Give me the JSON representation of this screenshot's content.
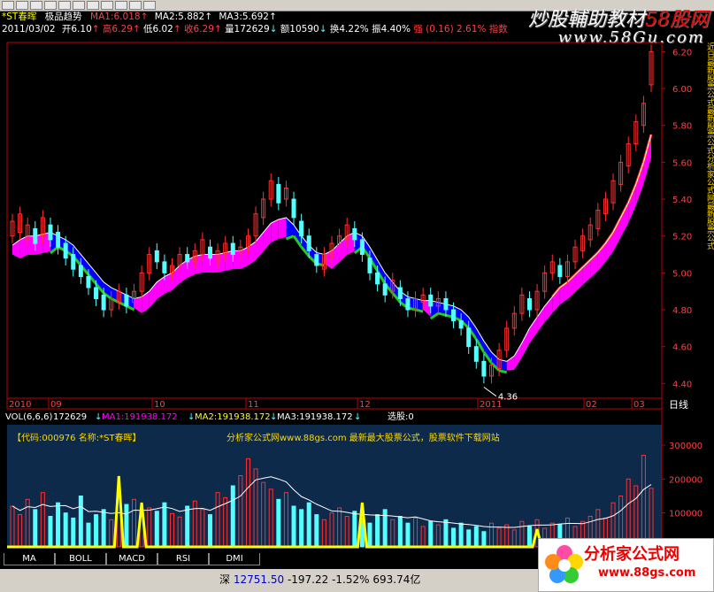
{
  "toolbar": {
    "buttons": [
      "box",
      "box",
      "box",
      "box",
      "box",
      "box",
      "box",
      "box",
      "box",
      "box",
      "box"
    ]
  },
  "info_line1": {
    "name": "*ST春晖",
    "indicator": "极品趋势",
    "ma1_label": "MA1:6.018",
    "ma1_arrow": "↑",
    "ma2_label": "MA2:5.882",
    "ma2_arrow": "↑",
    "ma3_label": "MA3:5.692",
    "ma3_arrow": "↑"
  },
  "info_line2": {
    "date": "2011/03/02",
    "open": "开6.10",
    "open_arrow": "↑",
    "high": "高6.29",
    "high_arrow": "↑",
    "low": "低6.02",
    "low_arrow": "↑",
    "close": "收6.29",
    "close_arrow": "↑",
    "volume": "量172629",
    "volume_arrow": "↓",
    "amount": "额10590",
    "amount_arrow": "↓",
    "turnover": "换4.22%",
    "amplitude": "振4.40%",
    "strength": "强 (0.16) 2.61%",
    "index": "指数"
  },
  "watermark": {
    "text_a": "炒股輔助教材",
    "brand": "58股网",
    "url": "www.58Gu.com"
  },
  "sidebar_text": "近日最新股票公式最新股票公式分析家公式网最新股票公式",
  "colors": {
    "up": "#ff3030",
    "down": "#54ffff",
    "bullish_band": "#ff00ff",
    "bearish_band": "#0000ff",
    "bear_edge": "#22cc22",
    "axis": "#c00000",
    "ma": "#ffffff",
    "signal": "#ffff00"
  },
  "chart_data": [
    {
      "type": "candlestick",
      "title": "",
      "y_ticks": [
        "6.20",
        "6.00",
        "5.80",
        "5.60",
        "5.40",
        "5.20",
        "5.00",
        "4.80",
        "4.60",
        "4.40"
      ],
      "ylim": [
        4.32,
        6.25
      ],
      "x_labels": [
        "2010",
        "09",
        "10",
        "11",
        "12",
        "2011",
        "02",
        "03"
      ],
      "period_label": "日线",
      "min_marker": "4.36",
      "trend": [
        5.15,
        5.18,
        5.2,
        5.2,
        5.21,
        5.22,
        5.2,
        5.18,
        5.15,
        5.1,
        5.05,
        5.0,
        4.95,
        4.92,
        4.9,
        4.88,
        4.86,
        4.87,
        4.9,
        4.95,
        4.98,
        5.0,
        5.04,
        5.07,
        5.09,
        5.1,
        5.1,
        5.1,
        5.11,
        5.12,
        5.12,
        5.14,
        5.17,
        5.22,
        5.27,
        5.29,
        5.3,
        5.26,
        5.2,
        5.15,
        5.11,
        5.1,
        5.12,
        5.16,
        5.2,
        5.22,
        5.2,
        5.14,
        5.07,
        5.0,
        4.95,
        4.9,
        4.87,
        4.86,
        4.85,
        4.85,
        4.84,
        4.83,
        4.82,
        4.8,
        4.76,
        4.7,
        4.63,
        4.57,
        4.53,
        4.52,
        4.55,
        4.62,
        4.7,
        4.76,
        4.82,
        4.87,
        4.92,
        4.95,
        4.99,
        5.03,
        5.07,
        5.11,
        5.16,
        5.22,
        5.3,
        5.38,
        5.48,
        5.6,
        5.75
      ],
      "candles": [
        [
          5.2,
          5.28
        ],
        [
          5.22,
          5.32
        ],
        [
          5.18,
          5.26
        ],
        [
          5.24,
          5.16
        ],
        [
          5.2,
          5.3
        ],
        [
          5.26,
          5.18
        ],
        [
          5.22,
          5.14
        ],
        [
          5.16,
          5.08
        ],
        [
          5.1,
          5.02
        ],
        [
          5.04,
          4.98
        ],
        [
          4.98,
          4.92
        ],
        [
          4.92,
          4.86
        ],
        [
          4.88,
          4.8
        ],
        [
          4.8,
          4.86
        ],
        [
          4.84,
          4.9
        ],
        [
          4.88,
          4.82
        ],
        [
          4.84,
          4.9
        ],
        [
          4.9,
          5.0
        ],
        [
          5.0,
          5.1
        ],
        [
          5.12,
          5.06
        ],
        [
          5.06,
          5.0
        ],
        [
          5.0,
          5.04
        ],
        [
          5.04,
          5.1
        ],
        [
          5.1,
          5.06
        ],
        [
          5.06,
          5.12
        ],
        [
          5.1,
          5.18
        ],
        [
          5.14,
          5.08
        ],
        [
          5.06,
          5.12
        ],
        [
          5.1,
          5.16
        ],
        [
          5.16,
          5.1
        ],
        [
          5.1,
          5.14
        ],
        [
          5.14,
          5.2
        ],
        [
          5.2,
          5.32
        ],
        [
          5.3,
          5.4
        ],
        [
          5.4,
          5.5
        ],
        [
          5.48,
          5.38
        ],
        [
          5.4,
          5.46
        ],
        [
          5.4,
          5.3
        ],
        [
          5.28,
          5.2
        ],
        [
          5.2,
          5.12
        ],
        [
          5.1,
          5.04
        ],
        [
          5.02,
          5.1
        ],
        [
          5.08,
          5.16
        ],
        [
          5.14,
          5.2
        ],
        [
          5.18,
          5.26
        ],
        [
          5.24,
          5.18
        ],
        [
          5.18,
          5.1
        ],
        [
          5.08,
          5.0
        ],
        [
          5.0,
          4.94
        ],
        [
          4.94,
          4.88
        ],
        [
          4.9,
          4.96
        ],
        [
          4.92,
          4.86
        ],
        [
          4.86,
          4.8
        ],
        [
          4.8,
          4.86
        ],
        [
          4.84,
          4.88
        ],
        [
          4.88,
          4.82
        ],
        [
          4.82,
          4.86
        ],
        [
          4.86,
          4.8
        ],
        [
          4.8,
          4.74
        ],
        [
          4.74,
          4.7
        ],
        [
          4.7,
          4.6
        ],
        [
          4.6,
          4.52
        ],
        [
          4.52,
          4.44
        ],
        [
          4.44,
          4.5
        ],
        [
          4.48,
          4.58
        ],
        [
          4.58,
          4.7
        ],
        [
          4.7,
          4.78
        ],
        [
          4.78,
          4.88
        ],
        [
          4.86,
          4.8
        ],
        [
          4.8,
          4.9
        ],
        [
          4.9,
          5.0
        ],
        [
          5.0,
          5.06
        ],
        [
          5.04,
          4.98
        ],
        [
          4.98,
          5.06
        ],
        [
          5.06,
          5.14
        ],
        [
          5.12,
          5.2
        ],
        [
          5.18,
          5.26
        ],
        [
          5.24,
          5.34
        ],
        [
          5.32,
          5.4
        ],
        [
          5.38,
          5.5
        ],
        [
          5.48,
          5.6
        ],
        [
          5.58,
          5.7
        ],
        [
          5.7,
          5.82
        ],
        [
          5.8,
          5.92
        ],
        [
          6.02,
          6.2
        ]
      ]
    },
    {
      "type": "bar",
      "title": "",
      "header": {
        "label": "VOL(6,6,6)",
        "vol": "172629",
        "vol_arrow": "↓",
        "ma1": "MA1:191938.172",
        "ma1_arrow": "↓",
        "ma2": "MA2:191938.172",
        "ma2_arrow": "↓",
        "ma3": "MA3:191938.172",
        "ma3_arrow": "↓",
        "xuangu": "选股:0"
      },
      "banner_code": "【代码:000976 名称:*ST春晖】",
      "banner_ad": "分析家公式网www.88gs.com 最新最大股票公式，股票软件下载网站",
      "y_ticks": [
        "300000",
        "200000",
        "100000"
      ],
      "ylim": [
        0,
        360000
      ],
      "values": [
        120000,
        95000,
        140000,
        110000,
        160000,
        90000,
        130000,
        100000,
        85000,
        150000,
        70000,
        95000,
        110000,
        80000,
        100000,
        125000,
        140000,
        90000,
        115000,
        105000,
        130000,
        98000,
        88000,
        120000,
        135000,
        110000,
        95000,
        160000,
        145000,
        180000,
        210000,
        260000,
        230000,
        190000,
        170000,
        140000,
        160000,
        120000,
        110000,
        130000,
        95000,
        80000,
        100000,
        115000,
        90000,
        105000,
        85000,
        70000,
        95000,
        110000,
        80000,
        90000,
        70000,
        85000,
        60000,
        75000,
        65000,
        80000,
        55000,
        70000,
        50000,
        60000,
        45000,
        70000,
        55000,
        65000,
        50000,
        75000,
        60000,
        80000,
        55000,
        70000,
        65000,
        85000,
        60000,
        75000,
        90000,
        110000,
        85000,
        130000,
        150000,
        200000,
        180000,
        270000,
        172629
      ]
    }
  ],
  "indicator_tabs": [
    "MA",
    "BOLL",
    "MACD",
    "RSI",
    "DMI"
  ],
  "status": {
    "exchange": "深",
    "index_value": "12751.50",
    "change": "-197.22",
    "pct": "-1.52%",
    "amount": "693.74亿"
  },
  "logo": {
    "title": "分析家公式网",
    "url": "www.88gs.com"
  }
}
